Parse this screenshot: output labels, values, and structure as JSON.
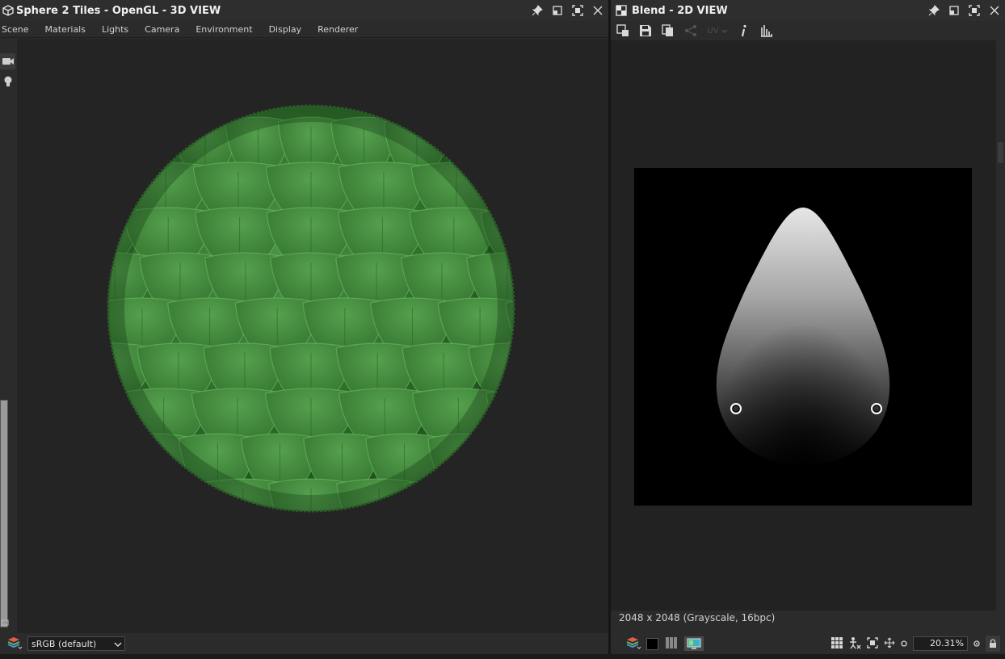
{
  "panel3d": {
    "title": "Sphere 2 Tiles - OpenGL - 3D VIEW",
    "menu": [
      "Scene",
      "Materials",
      "Lights",
      "Camera",
      "Environment",
      "Display",
      "Renderer"
    ],
    "color_space": "sRGB (default)",
    "sphere_color": "#3a7a36",
    "icons": [
      "cube-icon",
      "pin-icon",
      "float-icon",
      "maximize-icon",
      "close-icon",
      "camera-icon",
      "light-bulb-icon",
      "layers-icon",
      "chevron-down-icon"
    ]
  },
  "panel2d": {
    "title": "Blend - 2D VIEW",
    "toolbar_uv": "UV",
    "image_info": "2048 x 2048 (Grayscale, 16bpc)",
    "zoom": "20.31%",
    "icons": [
      "checker-icon",
      "export-icon",
      "save-icon",
      "copy-icon",
      "share-icon",
      "info-icon",
      "histogram-icon",
      "grid-icon",
      "fit-icon",
      "frame-icon",
      "move-icon",
      "lock-icon"
    ]
  },
  "colors": {
    "panel_bg": "#2b2b2b",
    "viewport_bg": "#242424",
    "accent": "#3c7a9a"
  }
}
